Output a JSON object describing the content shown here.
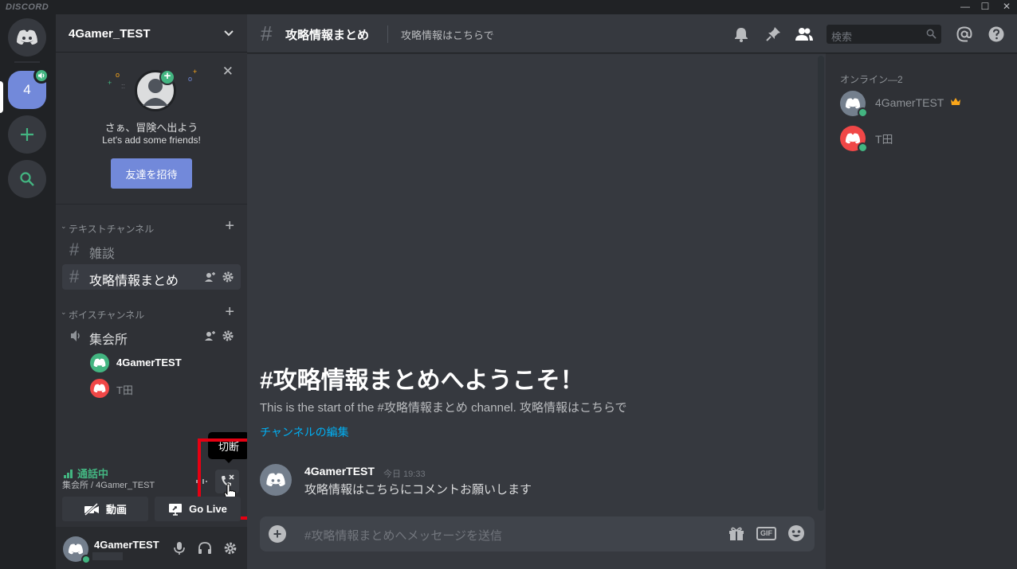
{
  "window": {
    "brand": "DISCORD",
    "minimize": "—",
    "maximize": "☐",
    "close": "✕"
  },
  "servers": {
    "current_label": "4"
  },
  "guild": {
    "name": "4Gamer_TEST"
  },
  "invite_card": {
    "title": "さぁ、冒険へ出よう",
    "subtitle": "Let's add some friends!",
    "button": "友達を招待"
  },
  "categories": {
    "text": "テキストチャンネル",
    "voice": "ボイスチャンネル"
  },
  "text_channels": [
    {
      "label": "雑談",
      "selected": false
    },
    {
      "label": "攻略情報まとめ",
      "selected": true
    }
  ],
  "voice_channel": {
    "label": "集会所",
    "users": [
      {
        "name": "4GamerTEST",
        "color": "#43b581"
      },
      {
        "name": "T田",
        "color": "#f04747"
      }
    ]
  },
  "voice_panel": {
    "status": "通話中",
    "location": "集会所 / 4Gamer_TEST",
    "video_label": "動画",
    "golive_label": "Go Live",
    "tooltip": "切断"
  },
  "user": {
    "name": "4GamerTEST"
  },
  "header": {
    "channel": "攻略情報まとめ",
    "topic": "攻略情報はこちらで",
    "search_placeholder": "検索"
  },
  "welcome": {
    "title": "#攻略情報まとめへようこそ！",
    "subtitle": "This is the start of the #攻略情報まとめ channel. 攻略情報はこちらで",
    "edit_link": "チャンネルの編集"
  },
  "message": {
    "author": "4GamerTEST",
    "time": "今日 19:33",
    "text": "攻略情報はこちらにコメントお願いします"
  },
  "composer": {
    "placeholder": "#攻略情報まとめへメッセージを送信",
    "gif_label": "GIF"
  },
  "members": {
    "category": "オンライン—2",
    "list": [
      {
        "name": "4GamerTEST",
        "color": "#747f8d",
        "owner": true
      },
      {
        "name": "T田",
        "color": "#f04747",
        "owner": false
      }
    ]
  },
  "colors": {
    "accent": "#7289da",
    "online": "#43b581",
    "link": "#00b0f4",
    "highlight_box": "#e60012"
  }
}
